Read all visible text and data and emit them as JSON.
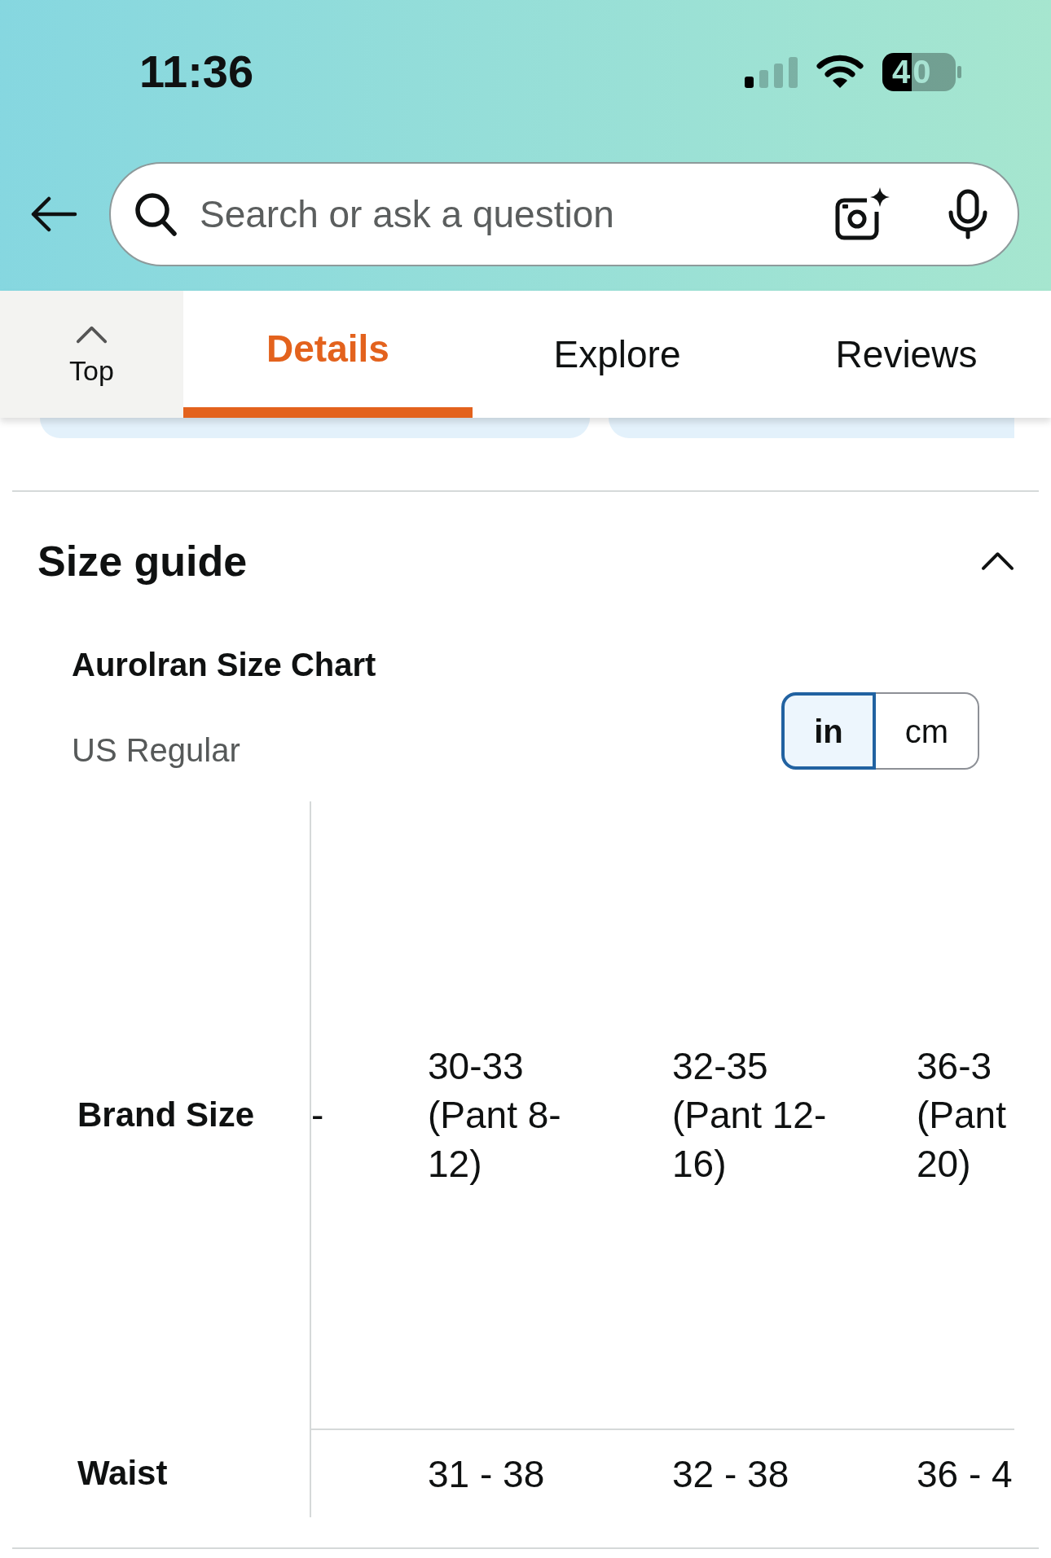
{
  "status_bar": {
    "time": "11:36",
    "battery": "40"
  },
  "search": {
    "placeholder": "Search or ask a question"
  },
  "top_button": {
    "label": "Top"
  },
  "tabs": [
    {
      "label": "Details",
      "selected": true
    },
    {
      "label": "Explore",
      "selected": false
    },
    {
      "label": "Reviews",
      "selected": false
    }
  ],
  "size_guide": {
    "title": "Size guide",
    "expanded": true,
    "chart_title": "Aurolran Size Chart",
    "region": "US Regular",
    "units": [
      {
        "label": "in",
        "selected": true
      },
      {
        "label": "cm",
        "selected": false
      }
    ],
    "table": {
      "rows": [
        {
          "label": "Brand Size",
          "cells": [
            {
              "lines": [
                "-"
              ]
            },
            {
              "lines": [
                "30-33",
                "(Pant 8-",
                "12)"
              ]
            },
            {
              "lines": [
                "32-35",
                "(Pant 12-",
                "16)"
              ]
            },
            {
              "lines": [
                "36-3",
                "(Pant",
                "20)"
              ]
            }
          ]
        },
        {
          "label": "Waist",
          "cells": [
            null,
            {
              "lines": [
                "31 - 38"
              ]
            },
            {
              "lines": [
                "32 - 38"
              ]
            },
            {
              "lines": [
                "36 - 4"
              ]
            }
          ]
        }
      ]
    }
  }
}
